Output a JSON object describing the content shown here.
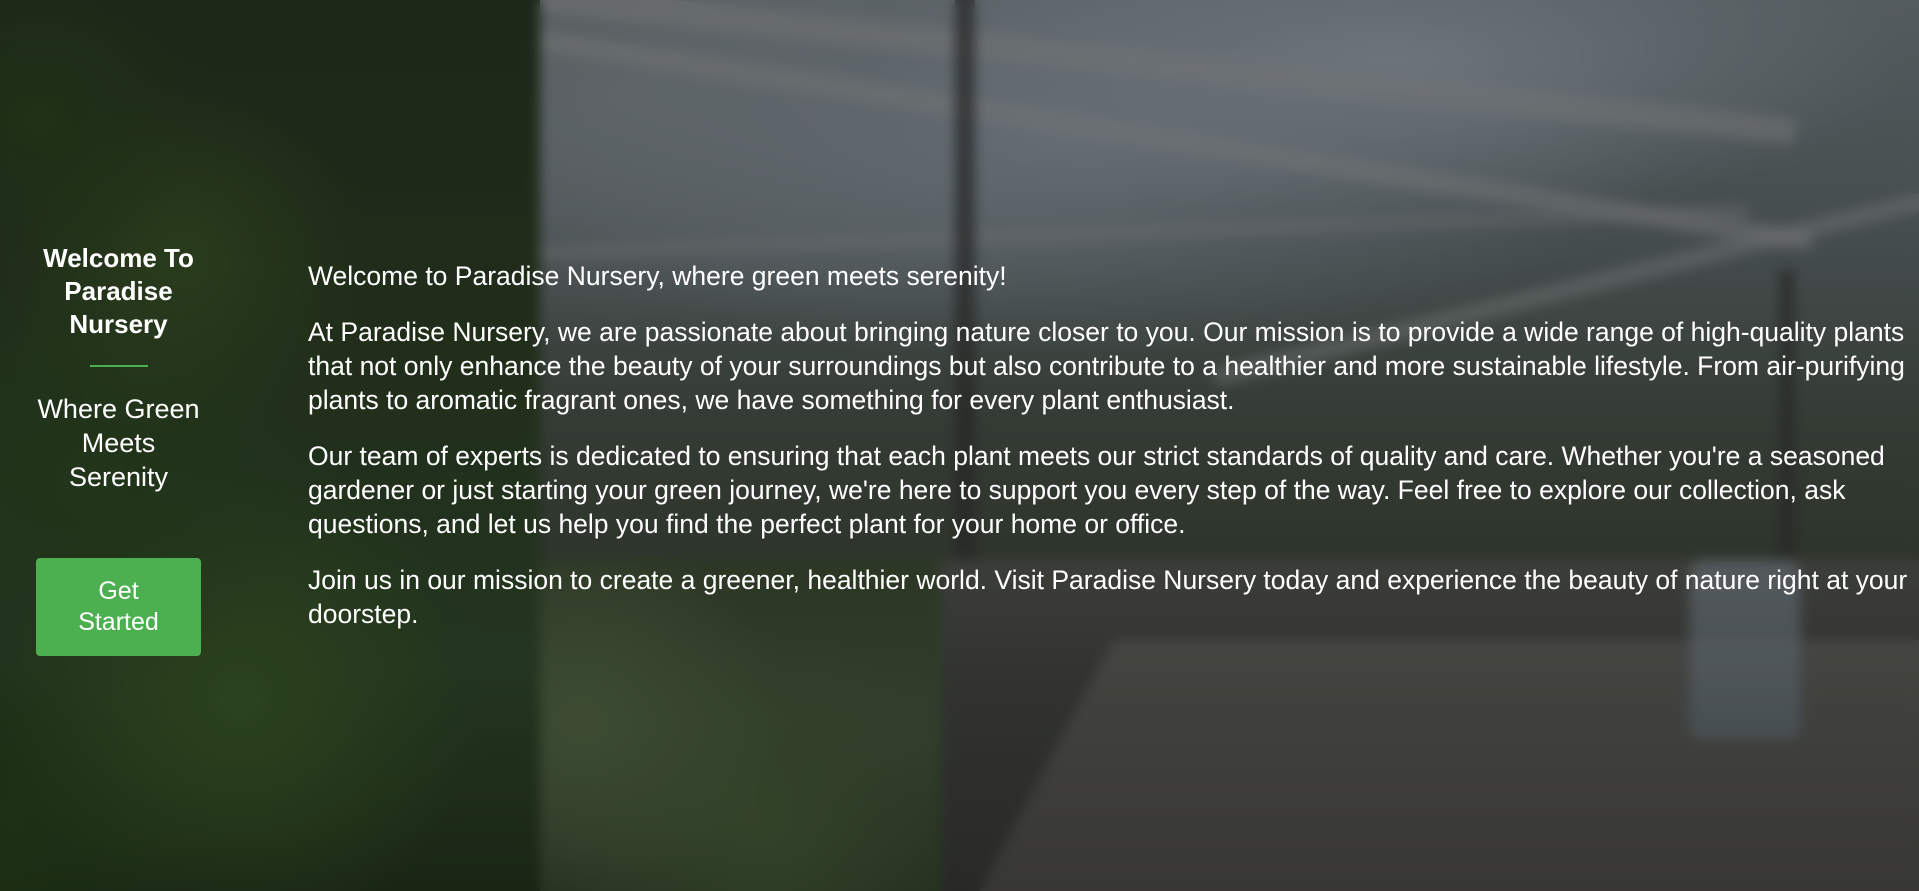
{
  "sidebar": {
    "title": "Welcome To Paradise Nursery",
    "tagline": "Where Green Meets Serenity",
    "button_label": "Get Started"
  },
  "content": {
    "paragraphs": [
      "Welcome to Paradise Nursery, where green meets serenity!",
      "At Paradise Nursery, we are passionate about bringing nature closer to you. Our mission is to provide a wide range of high-quality plants that not only enhance the beauty of your surroundings but also contribute to a healthier and more sustainable lifestyle. From air-purifying plants to aromatic fragrant ones, we have something for every plant enthusiast.",
      "Our team of experts is dedicated to ensuring that each plant meets our strict standards of quality and care. Whether you're a seasoned gardener or just starting your green journey, we're here to support you every step of the way. Feel free to explore our collection, ask questions, and let us help you find the perfect plant for your home or office.",
      "Join us in our mission to create a greener, healthier world. Visit Paradise Nursery today and experience the beauty of nature right at your doorstep."
    ]
  },
  "colors": {
    "accent": "#4caf50",
    "text": "#ffffff",
    "overlay": "rgba(0,0,0,0.45)"
  }
}
